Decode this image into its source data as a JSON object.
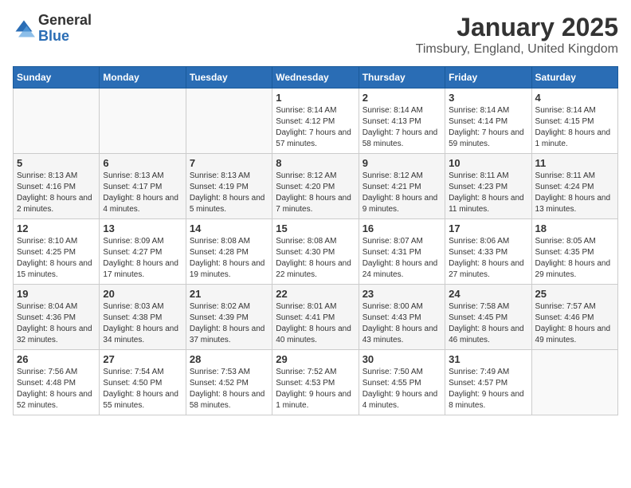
{
  "logo": {
    "text_general": "General",
    "text_blue": "Blue"
  },
  "title": "January 2025",
  "location": "Timsbury, England, United Kingdom",
  "days_of_week": [
    "Sunday",
    "Monday",
    "Tuesday",
    "Wednesday",
    "Thursday",
    "Friday",
    "Saturday"
  ],
  "weeks": [
    {
      "shaded": false,
      "days": [
        {
          "number": "",
          "info": ""
        },
        {
          "number": "",
          "info": ""
        },
        {
          "number": "",
          "info": ""
        },
        {
          "number": "1",
          "info": "Sunrise: 8:14 AM\nSunset: 4:12 PM\nDaylight: 7 hours and 57 minutes."
        },
        {
          "number": "2",
          "info": "Sunrise: 8:14 AM\nSunset: 4:13 PM\nDaylight: 7 hours and 58 minutes."
        },
        {
          "number": "3",
          "info": "Sunrise: 8:14 AM\nSunset: 4:14 PM\nDaylight: 7 hours and 59 minutes."
        },
        {
          "number": "4",
          "info": "Sunrise: 8:14 AM\nSunset: 4:15 PM\nDaylight: 8 hours and 1 minute."
        }
      ]
    },
    {
      "shaded": true,
      "days": [
        {
          "number": "5",
          "info": "Sunrise: 8:13 AM\nSunset: 4:16 PM\nDaylight: 8 hours and 2 minutes."
        },
        {
          "number": "6",
          "info": "Sunrise: 8:13 AM\nSunset: 4:17 PM\nDaylight: 8 hours and 4 minutes."
        },
        {
          "number": "7",
          "info": "Sunrise: 8:13 AM\nSunset: 4:19 PM\nDaylight: 8 hours and 5 minutes."
        },
        {
          "number": "8",
          "info": "Sunrise: 8:12 AM\nSunset: 4:20 PM\nDaylight: 8 hours and 7 minutes."
        },
        {
          "number": "9",
          "info": "Sunrise: 8:12 AM\nSunset: 4:21 PM\nDaylight: 8 hours and 9 minutes."
        },
        {
          "number": "10",
          "info": "Sunrise: 8:11 AM\nSunset: 4:23 PM\nDaylight: 8 hours and 11 minutes."
        },
        {
          "number": "11",
          "info": "Sunrise: 8:11 AM\nSunset: 4:24 PM\nDaylight: 8 hours and 13 minutes."
        }
      ]
    },
    {
      "shaded": false,
      "days": [
        {
          "number": "12",
          "info": "Sunrise: 8:10 AM\nSunset: 4:25 PM\nDaylight: 8 hours and 15 minutes."
        },
        {
          "number": "13",
          "info": "Sunrise: 8:09 AM\nSunset: 4:27 PM\nDaylight: 8 hours and 17 minutes."
        },
        {
          "number": "14",
          "info": "Sunrise: 8:08 AM\nSunset: 4:28 PM\nDaylight: 8 hours and 19 minutes."
        },
        {
          "number": "15",
          "info": "Sunrise: 8:08 AM\nSunset: 4:30 PM\nDaylight: 8 hours and 22 minutes."
        },
        {
          "number": "16",
          "info": "Sunrise: 8:07 AM\nSunset: 4:31 PM\nDaylight: 8 hours and 24 minutes."
        },
        {
          "number": "17",
          "info": "Sunrise: 8:06 AM\nSunset: 4:33 PM\nDaylight: 8 hours and 27 minutes."
        },
        {
          "number": "18",
          "info": "Sunrise: 8:05 AM\nSunset: 4:35 PM\nDaylight: 8 hours and 29 minutes."
        }
      ]
    },
    {
      "shaded": true,
      "days": [
        {
          "number": "19",
          "info": "Sunrise: 8:04 AM\nSunset: 4:36 PM\nDaylight: 8 hours and 32 minutes."
        },
        {
          "number": "20",
          "info": "Sunrise: 8:03 AM\nSunset: 4:38 PM\nDaylight: 8 hours and 34 minutes."
        },
        {
          "number": "21",
          "info": "Sunrise: 8:02 AM\nSunset: 4:39 PM\nDaylight: 8 hours and 37 minutes."
        },
        {
          "number": "22",
          "info": "Sunrise: 8:01 AM\nSunset: 4:41 PM\nDaylight: 8 hours and 40 minutes."
        },
        {
          "number": "23",
          "info": "Sunrise: 8:00 AM\nSunset: 4:43 PM\nDaylight: 8 hours and 43 minutes."
        },
        {
          "number": "24",
          "info": "Sunrise: 7:58 AM\nSunset: 4:45 PM\nDaylight: 8 hours and 46 minutes."
        },
        {
          "number": "25",
          "info": "Sunrise: 7:57 AM\nSunset: 4:46 PM\nDaylight: 8 hours and 49 minutes."
        }
      ]
    },
    {
      "shaded": false,
      "days": [
        {
          "number": "26",
          "info": "Sunrise: 7:56 AM\nSunset: 4:48 PM\nDaylight: 8 hours and 52 minutes."
        },
        {
          "number": "27",
          "info": "Sunrise: 7:54 AM\nSunset: 4:50 PM\nDaylight: 8 hours and 55 minutes."
        },
        {
          "number": "28",
          "info": "Sunrise: 7:53 AM\nSunset: 4:52 PM\nDaylight: 8 hours and 58 minutes."
        },
        {
          "number": "29",
          "info": "Sunrise: 7:52 AM\nSunset: 4:53 PM\nDaylight: 9 hours and 1 minute."
        },
        {
          "number": "30",
          "info": "Sunrise: 7:50 AM\nSunset: 4:55 PM\nDaylight: 9 hours and 4 minutes."
        },
        {
          "number": "31",
          "info": "Sunrise: 7:49 AM\nSunset: 4:57 PM\nDaylight: 9 hours and 8 minutes."
        },
        {
          "number": "",
          "info": ""
        }
      ]
    }
  ]
}
